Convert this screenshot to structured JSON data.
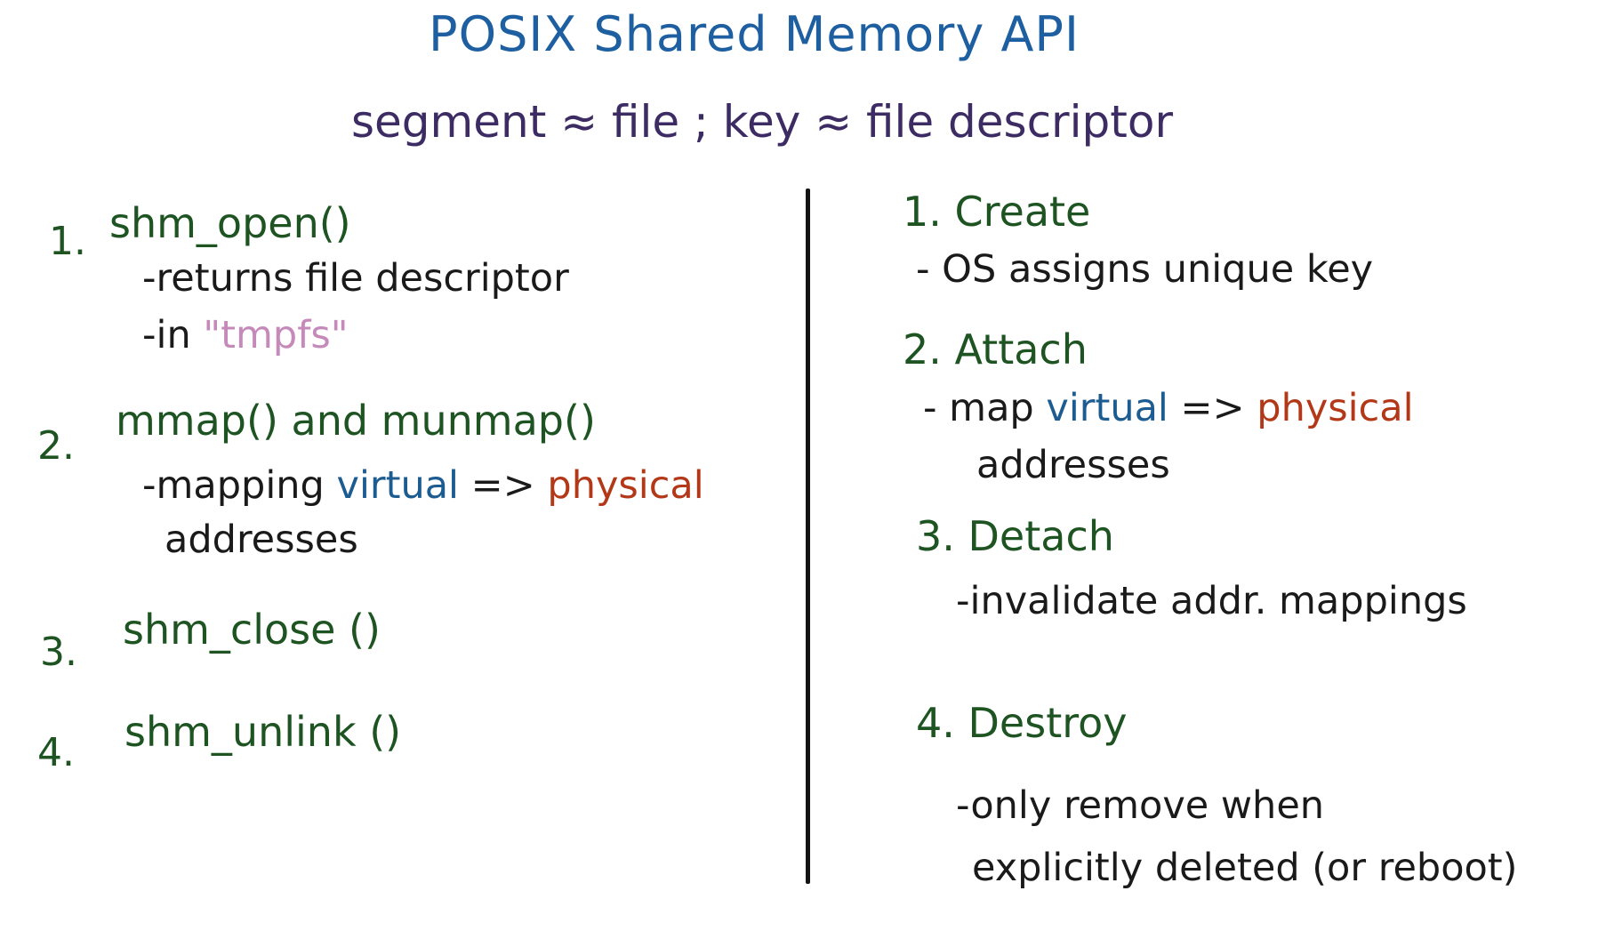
{
  "title": "POSIX Shared Memory API",
  "subtitle": "segment ≈ file ; key ≈ file descriptor",
  "left": {
    "item1": {
      "num": "1.",
      "name": "shm_open()",
      "line1": "-returns file descriptor",
      "line2_prefix": "-in",
      "line2_value": "\"tmpfs\""
    },
    "item2": {
      "num": "2.",
      "name": "mmap() and munmap()",
      "prefix": "-mapping",
      "virtual": "virtual",
      "arrow": "=>",
      "physical": "physical",
      "line2": "addresses"
    },
    "item3": {
      "num": "3.",
      "name": "shm_close ()"
    },
    "item4": {
      "num": "4.",
      "name": "shm_unlink ()"
    }
  },
  "right": {
    "item1": {
      "label": "1. Create",
      "line1": "- OS assigns unique key"
    },
    "item2": {
      "label": "2. Attach",
      "prefix": "- map",
      "virtual": "virtual",
      "arrow": "=>",
      "physical": "physical",
      "line2": "addresses"
    },
    "item3": {
      "label": "3. Detach",
      "line1": "-invalidate addr. mappings"
    },
    "item4": {
      "label": "4. Destroy",
      "line1": "-only remove when",
      "line2": "explicitly deleted (or reboot)"
    }
  }
}
